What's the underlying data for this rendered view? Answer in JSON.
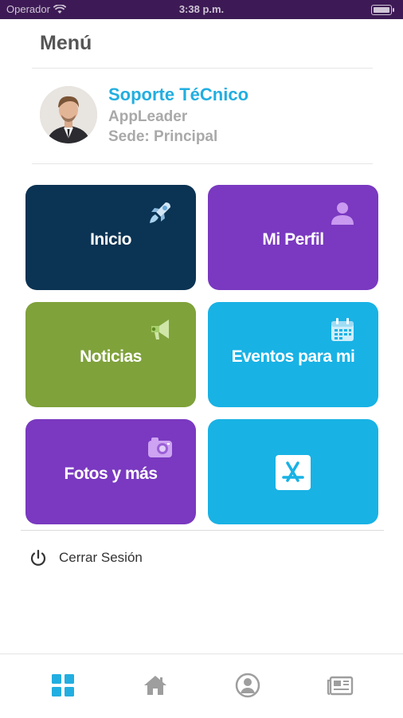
{
  "status_bar": {
    "carrier": "Operador",
    "time": "3:38 p.m."
  },
  "menu": {
    "title": "Menú"
  },
  "user": {
    "name": "Soporte TéCnico",
    "app": "AppLeader",
    "sede": "Sede: Principal"
  },
  "tiles": [
    {
      "label": "Inicio",
      "color": "#0b3353",
      "icon": "rocket-icon"
    },
    {
      "label": "Mi Perfil",
      "color": "#7a39c0",
      "icon": "user-icon"
    },
    {
      "label": "Noticias",
      "color": "#7fa23b",
      "icon": "megaphone-icon"
    },
    {
      "label": "Eventos para mi",
      "color": "#18b2e5",
      "icon": "calendar-icon"
    },
    {
      "label": "Fotos y más",
      "color": "#7a39c0",
      "icon": "camera-icon"
    },
    {
      "label": "",
      "color": "#18b2e5",
      "icon": "app-store-icon"
    }
  ],
  "logout": {
    "label": "Cerrar Sesión"
  },
  "tabbar": {
    "items": [
      "grid-icon",
      "home-icon",
      "profile-icon",
      "news-icon"
    ],
    "active_color": "#22aee0",
    "inactive_color": "#9e9e9e"
  }
}
